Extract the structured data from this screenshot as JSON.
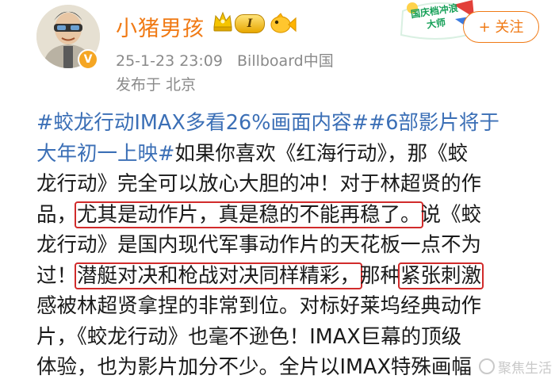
{
  "header": {
    "username": "小猪男孩",
    "level": "I",
    "timestamp": "25-1-23 23:09",
    "source": "Billboard中国",
    "location": "发布于 北京",
    "follow_label": "+ 关注",
    "promo_text": "国庆档冲浪大师"
  },
  "post": {
    "lines": [
      [
        {
          "t": "#蛟龙行动IMAX多看26%画面内容##6部影片将于",
          "s": "hashtag"
        }
      ],
      [
        {
          "t": "大年初一上映#",
          "s": "hashtag"
        },
        {
          "t": "如果你喜欢《红海行动》，那《蛟",
          "s": ""
        }
      ],
      [
        {
          "t": "龙行动》完全可以放心大胆的冲！对于林超贤的作",
          "s": ""
        }
      ],
      [
        {
          "t": "品，",
          "s": ""
        },
        {
          "t": "尤其是动作片，真是稳的不能再稳了。",
          "s": "hl"
        },
        {
          "t": "说《蛟",
          "s": ""
        }
      ],
      [
        {
          "t": "龙行动》是国内现代军事动作片的天花板一点不为",
          "s": ""
        }
      ],
      [
        {
          "t": "过！",
          "s": ""
        },
        {
          "t": "潜艇对决和枪战对决同样精彩，",
          "s": "hl"
        },
        {
          "t": "那种",
          "s": ""
        },
        {
          "t": "紧张刺激",
          "s": "hl"
        }
      ],
      [
        {
          "t": "感被林超贤拿捏的非常到位。对标好莱坞经典动作",
          "s": ""
        }
      ],
      [
        {
          "t": "片，《蛟龙行动》也毫不逊色！IMAX巨幕的顶级",
          "s": ""
        }
      ],
      [
        {
          "t": "体验，也为影片加分不少。全片以IMAX特殊画幅",
          "s": ""
        }
      ]
    ]
  },
  "watermark": "聚焦生活",
  "colors": {
    "accent": "#f07a15",
    "hashtag": "#3b6fb6",
    "highlight": "#d12b2b"
  }
}
